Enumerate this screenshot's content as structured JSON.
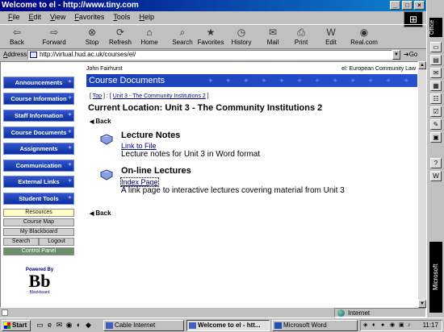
{
  "window": {
    "title": "Welcome to el - http://www.tiny.com"
  },
  "menu": [
    "File",
    "Edit",
    "View",
    "Favorites",
    "Tools",
    "Help"
  ],
  "toolbar": [
    {
      "label": "Back",
      "icon": "back-arrow-icon",
      "glyph": "⇦"
    },
    {
      "label": "Forward",
      "icon": "forward-arrow-icon",
      "glyph": "⇨"
    },
    {
      "label": "Stop",
      "icon": "stop-icon",
      "glyph": "⊗"
    },
    {
      "label": "Refresh",
      "icon": "refresh-icon",
      "glyph": "⟳"
    },
    {
      "label": "Home",
      "icon": "home-icon",
      "glyph": "⌂"
    },
    {
      "label": "Search",
      "icon": "search-icon",
      "glyph": "⌕"
    },
    {
      "label": "Favorites",
      "icon": "favorites-icon",
      "glyph": "★"
    },
    {
      "label": "History",
      "icon": "history-icon",
      "glyph": "◷"
    },
    {
      "label": "Mail",
      "icon": "mail-icon",
      "glyph": "✉"
    },
    {
      "label": "Print",
      "icon": "print-icon",
      "glyph": "⎙"
    },
    {
      "label": "Edit",
      "icon": "edit-icon",
      "glyph": "W"
    },
    {
      "label": "Real.com",
      "icon": "realcom-icon",
      "glyph": "◉"
    }
  ],
  "address": {
    "label": "Address",
    "url": "http://virtual.hud.ac.uk/courses/el/",
    "go": "Go"
  },
  "sidebar": {
    "nav": [
      "Announcements",
      "Course Information",
      "Staff Information",
      "Course Documents",
      "Assignments",
      "Communication",
      "External Links",
      "Student Tools"
    ],
    "tools": {
      "resources": "Resources",
      "course_map": "Course Map",
      "my_blackboard": "My Blackboard",
      "search": "Search",
      "logout": "Logout",
      "control_panel": "Control Panel"
    },
    "logo": {
      "powered": "Powered By",
      "mark": "Bb",
      "name": "Blackboard"
    }
  },
  "main": {
    "user": "John Fairhurst",
    "course": "el: European Community Law",
    "banner": "Course Documents",
    "breadcrumb": {
      "top": "Top",
      "unit": "Unit 3 - The Community Institutions 2"
    },
    "location": "Current Location: Unit 3 - The Community Institutions 2",
    "back": "Back",
    "items": [
      {
        "title": "Lecture Notes",
        "link": "Link to File",
        "desc": "Lecture notes for Unit 3 in Word format"
      },
      {
        "title": "On-line Lectures",
        "link": "Index Page",
        "desc": "A link page to interactive lectures covering material from Unit 3"
      }
    ]
  },
  "status": {
    "zone": "Internet"
  },
  "office": {
    "title": "Office",
    "brand": "Microsoft"
  },
  "taskbar": {
    "start": "Start",
    "tasks": [
      "Cable Internet",
      "Welcome to el - htt...",
      "Microsoft Word"
    ],
    "clock": "11:17"
  }
}
